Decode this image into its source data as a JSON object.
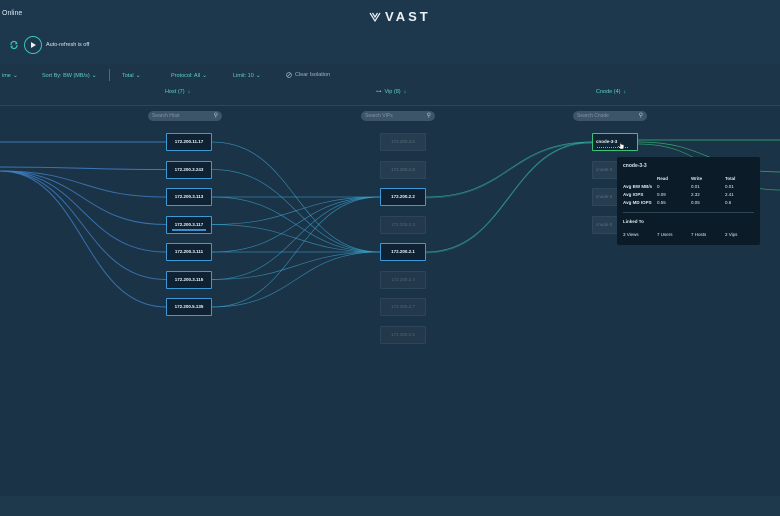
{
  "app": {
    "status": "Online",
    "brand": "VAST"
  },
  "toolbar": {
    "auto_refresh_label": "Auto-refresh is off"
  },
  "filters": {
    "time": "ime",
    "sort_by": "Sort By: BW (MB/s)",
    "total": "Total",
    "protocol": "Protocol: All",
    "limit": "Limit: 10",
    "clear_isolation": "Clear Isolation"
  },
  "columns": {
    "host": {
      "title": "Host (7)",
      "search_placeholder": "Search Host"
    },
    "vip": {
      "title": "Vip (8)",
      "search_placeholder": "Search VIPs"
    },
    "cnode": {
      "title": "Cnode (4)",
      "search_placeholder": "Search Cnode"
    }
  },
  "hosts": [
    "172.200.11.17",
    "172.200.3.243",
    "172.200.3.113",
    "172.200.3.117",
    "172.200.3.111",
    "172.200.3.115",
    "172.200.5.135"
  ],
  "vips": [
    {
      "ip": "172.200.2.6",
      "active": false
    },
    {
      "ip": "172.200.2.8",
      "active": false
    },
    {
      "ip": "172.200.2.2",
      "active": true
    },
    {
      "ip": "172.200.2.3",
      "active": false
    },
    {
      "ip": "172.200.2.1",
      "active": true
    },
    {
      "ip": "172.200.2.4",
      "active": false
    },
    {
      "ip": "172.200.2.7",
      "active": false
    },
    {
      "ip": "172.200.2.5",
      "active": false
    }
  ],
  "cnodes": [
    {
      "name": "cnode-3-3",
      "active": true
    },
    {
      "name": "cnode-3",
      "active": false
    },
    {
      "name": "cnode-3",
      "active": false
    },
    {
      "name": "cnode-3",
      "active": false
    }
  ],
  "tooltip": {
    "title": "cnode-3-3",
    "headers": [
      "",
      "Read",
      "Write",
      "Total"
    ],
    "rows": [
      [
        "Avg BW MB/s",
        "0",
        "0.01",
        "0.01"
      ],
      [
        "Avg IOPS",
        "0.09",
        "2.32",
        "2.41"
      ],
      [
        "Avg MD IOPS",
        "0.55",
        "0.05",
        "0.6"
      ]
    ],
    "linked_title": "Linked To",
    "linked": [
      "3 Views",
      "7 Users",
      "7 Hosts",
      "2 Vips"
    ]
  },
  "colors": {
    "background": "#1b3347",
    "accent": "#5fd0c4",
    "node_border": "#3e9ad6",
    "cnode_border": "#3ac47a"
  }
}
